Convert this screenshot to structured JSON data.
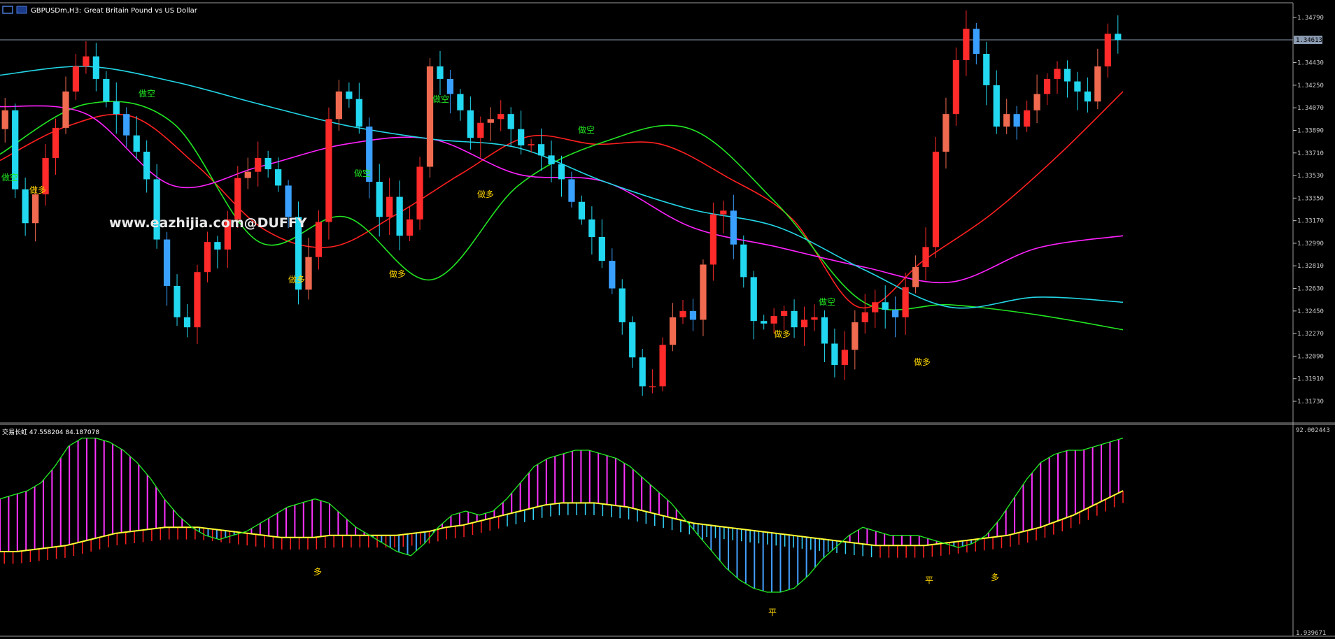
{
  "header": {
    "symbol": "GBPUSDm,H3:",
    "description": "Great Britain Pound vs US Dollar"
  },
  "watermark": "www.eazhijia.com@DUFFY",
  "indicator_label": "交易长虹 47.558204 84.187078",
  "current_price": "1.34613",
  "colors": {
    "bull_candle": "#ff2a2a",
    "bull_candle_light": "#f06a50",
    "bear_candle": "#22d8f0",
    "bear_candle_blue": "#3aa0ff",
    "ma_red": "#ff2020",
    "ma_green": "#22e622",
    "ma_magenta": "#ff22ff",
    "ma_cyan": "#22d6e6",
    "signal_buy": "#ffd700",
    "signal_sell": "#22e622",
    "osc_magenta": "#ff33ff",
    "osc_blue": "#44a0ff",
    "osc_cyan": "#33d6ff",
    "osc_red": "#ff2020",
    "osc_yellow": "#ffff33",
    "osc_green": "#22ee22",
    "axis": "#c8c8c8",
    "grid_line": "#8a9ab0"
  },
  "chart_data": [
    {
      "type": "candlestick",
      "title": "GBPUSDm,H3: Great Britain Pound vs US Dollar",
      "y_ticks": [
        "1.34790",
        "1.34430",
        "1.34250",
        "1.34070",
        "1.33890",
        "1.33710",
        "1.33530",
        "1.33350",
        "1.33170",
        "1.32990",
        "1.32810",
        "1.32630",
        "1.32450",
        "1.32270",
        "1.32090",
        "1.31910",
        "1.31730"
      ],
      "ylim": [
        1.3164,
        1.3486
      ],
      "current_price": 1.34613,
      "closes_approx": [
        1.3405,
        1.3342,
        1.3315,
        1.3338,
        1.3367,
        1.3391,
        1.342,
        1.344,
        1.3448,
        1.343,
        1.3412,
        1.3402,
        1.3385,
        1.3372,
        1.335,
        1.3302,
        1.3265,
        1.324,
        1.3232,
        1.3276,
        1.33,
        1.3294,
        1.3318,
        1.3351,
        1.3356,
        1.3367,
        1.3358,
        1.3345,
        1.332,
        1.3262,
        1.3288,
        1.3316,
        1.3398,
        1.342,
        1.3414,
        1.3392,
        1.3348,
        1.332,
        1.3336,
        1.3305,
        1.3318,
        1.336,
        1.344,
        1.343,
        1.3418,
        1.3405,
        1.3383,
        1.3395,
        1.3398,
        1.3402,
        1.339,
        1.3377,
        1.3378,
        1.3369,
        1.3362,
        1.335,
        1.3332,
        1.3318,
        1.3304,
        1.3285,
        1.3263,
        1.3236,
        1.3208,
        1.3185,
        1.3185,
        1.3218,
        1.324,
        1.3245,
        1.3238,
        1.3282,
        1.3322,
        1.3325,
        1.3298,
        1.3272,
        1.3237,
        1.3235,
        1.3241,
        1.3245,
        1.3232,
        1.3238,
        1.324,
        1.3219,
        1.3202,
        1.3214,
        1.3236,
        1.3244,
        1.3252,
        1.3246,
        1.324,
        1.3264,
        1.328,
        1.3296,
        1.3372,
        1.3402,
        1.3445,
        1.347,
        1.345,
        1.3425,
        1.3392,
        1.3402,
        1.3392,
        1.3405,
        1.3418,
        1.343,
        1.3438,
        1.3428,
        1.342,
        1.3412,
        1.344,
        1.3466,
        1.3461
      ],
      "moving_averages": [
        {
          "color": "red",
          "path_approx": [
            1.3365,
            1.3392,
            1.34,
            1.336,
            1.331,
            1.3296,
            1.3322,
            1.3355,
            1.3384,
            1.3378,
            1.3378,
            1.3352,
            1.3318,
            1.3248,
            1.3286,
            1.3322,
            1.3368,
            1.342
          ]
        },
        {
          "color": "green",
          "path_approx": [
            1.337,
            1.341,
            1.3395,
            1.33,
            1.332,
            1.327,
            1.3345,
            1.338,
            1.339,
            1.333,
            1.3252,
            1.325,
            1.3242,
            1.323
          ]
        },
        {
          "color": "magenta",
          "path_approx": [
            1.3408,
            1.3402,
            1.3345,
            1.336,
            1.3378,
            1.3382,
            1.3354,
            1.3348,
            1.3312,
            1.3296,
            1.328,
            1.3268,
            1.3295,
            1.3305
          ]
        },
        {
          "color": "cyan",
          "path_approx": [
            1.3433,
            1.344,
            1.3428,
            1.341,
            1.3393,
            1.3382,
            1.3375,
            1.3348,
            1.3326,
            1.3312,
            1.3278,
            1.3248,
            1.3256,
            1.3252
          ]
        }
      ],
      "signals": [
        {
          "label": "做空",
          "kind": "sell"
        },
        {
          "label": "做多",
          "kind": "buy"
        },
        {
          "label": "做空",
          "kind": "sell"
        },
        {
          "label": "做多",
          "kind": "buy"
        },
        {
          "label": "做空",
          "kind": "sell"
        },
        {
          "label": "做多",
          "kind": "buy"
        },
        {
          "label": "做空",
          "kind": "sell"
        },
        {
          "label": "做多",
          "kind": "buy"
        },
        {
          "label": "做空",
          "kind": "sell"
        },
        {
          "label": "做多",
          "kind": "buy"
        },
        {
          "label": "做空",
          "kind": "sell"
        },
        {
          "label": "做多",
          "kind": "buy"
        }
      ]
    },
    {
      "type": "oscillator",
      "title": "交易长虹 47.558204 84.187078",
      "y_ticks": [
        "92.002443",
        "1.939671"
      ],
      "ylim": [
        1.939671,
        92.002443
      ],
      "signals": [
        {
          "label": "多"
        },
        {
          "label": "平"
        },
        {
          "label": "平"
        },
        {
          "label": "多"
        }
      ]
    }
  ]
}
